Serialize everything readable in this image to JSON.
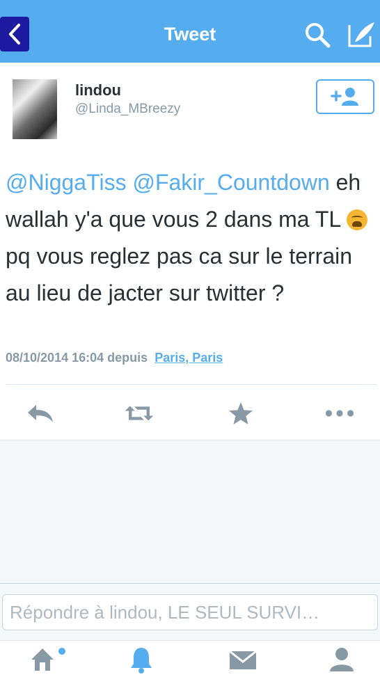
{
  "colors": {
    "accent": "#55acee",
    "back_button": "#1d1aa0",
    "text": "#292f33",
    "muted": "#8899a6",
    "emoji": "#f5b535"
  },
  "nav": {
    "title": "Tweet",
    "back_icon": "chevron-left-icon",
    "search_icon": "search-icon",
    "compose_icon": "compose-icon"
  },
  "tweet": {
    "author_name": "lindou",
    "author_handle": "@Linda_MBreezy",
    "follow_icon": "follow-user-icon",
    "mention_1": "@NiggaTiss",
    "mention_2": "@Fakir_Countdown",
    "text_part_1": "eh wallah y'a que vous 2 dans ma TL ",
    "emoji": "weary-face-emoji",
    "text_part_2": "pq vous reglez pas ca sur le terrain au lieu de jacter sur twitter ?",
    "timestamp": "08/10/2014 16:04",
    "via": "depuis",
    "location": "Paris, Paris"
  },
  "actions": [
    "reply-icon",
    "retweet-icon",
    "favorite-icon",
    "more-icon"
  ],
  "reply": {
    "placeholder": "Répondre à lindou, LE SEUL SURVI…"
  },
  "tabs": [
    "home-icon",
    "notifications-icon",
    "messages-icon",
    "profile-icon"
  ]
}
